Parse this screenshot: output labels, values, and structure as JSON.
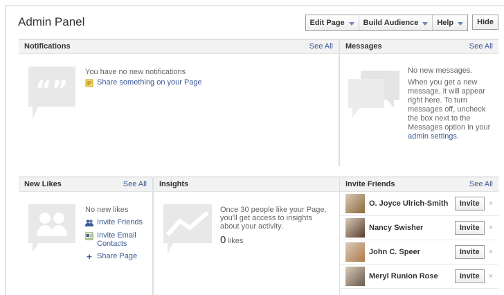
{
  "header": {
    "title": "Admin Panel",
    "edit_page": "Edit Page",
    "build_audience": "Build Audience",
    "help": "Help",
    "hide": "Hide"
  },
  "notifications": {
    "title": "Notifications",
    "see_all": "See All",
    "empty": "You have no new notifications",
    "share": "Share something on your Page"
  },
  "messages": {
    "title": "Messages",
    "see_all": "See All",
    "empty": "No new messages.",
    "info": "When you get a new message, it will appear right here. To turn messages off, uncheck the box next to the Messages option in your",
    "link": "admin settings",
    "end": "."
  },
  "new_likes": {
    "title": "New Likes",
    "see_all": "See All",
    "empty": "No new likes",
    "invite_friends": "Invite Friends",
    "invite_email": "Invite Email Contacts",
    "share_page": "Share Page"
  },
  "insights": {
    "title": "Insights",
    "info": "Once 30 people like your Page, you'll get access to insights about your activity.",
    "count": "0",
    "count_label": "likes"
  },
  "invite": {
    "title": "Invite Friends",
    "see_all": "See All",
    "button": "Invite",
    "close": "×",
    "friends": [
      {
        "name": "O. Joyce Ulrich-Smith",
        "color": "#8a6a3a"
      },
      {
        "name": "Nancy Swisher",
        "color": "#5a3b2e"
      },
      {
        "name": "John C. Speer",
        "color": "#b07a4a"
      },
      {
        "name": "Meryl Runion Rose",
        "color": "#6b5a4e"
      }
    ]
  }
}
